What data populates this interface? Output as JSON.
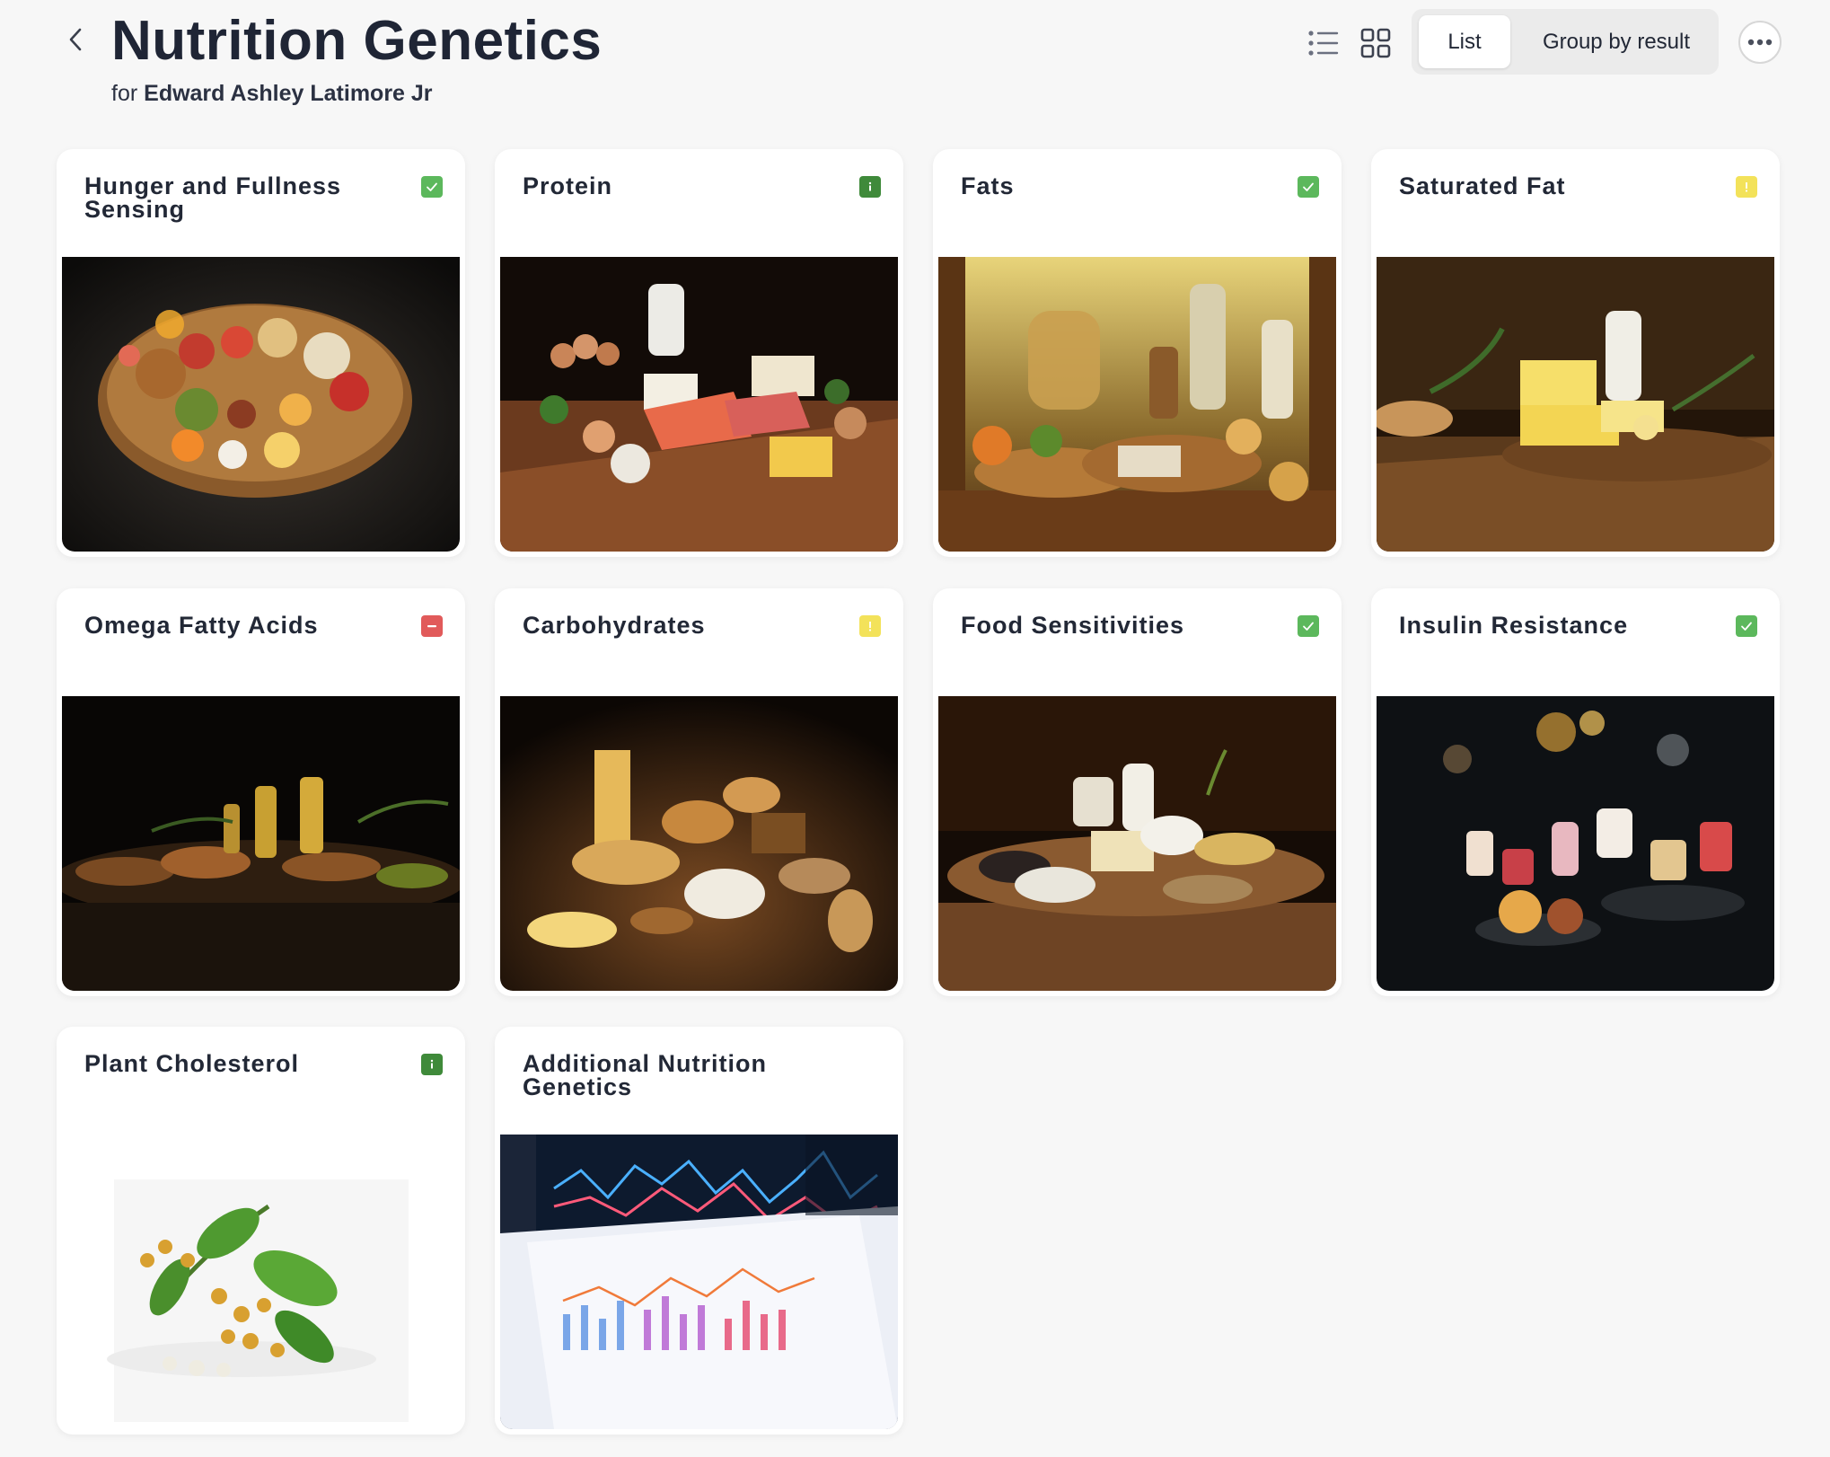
{
  "header": {
    "title": "Nutrition Genetics",
    "subtitle_prefix": "for",
    "person_name": "Edward Ashley Latimore Jr"
  },
  "toolbar": {
    "list_view_icon": "list-view-icon",
    "grid_view_icon": "grid-view-icon",
    "segments": [
      "List",
      "Group by result"
    ],
    "active_segment": "List",
    "more_icon": "more-options-icon"
  },
  "status_colors": {
    "check": "#5cb85c",
    "info": "#3f8a3a",
    "warning": "#f3e25a",
    "minus": "#e15a5a"
  },
  "cards": [
    {
      "title": "Hunger and Fullness Sensing",
      "status": "check",
      "image": "food-platter-image"
    },
    {
      "title": "Protein",
      "status": "info",
      "image": "protein-foods-image"
    },
    {
      "title": "Fats",
      "status": "check",
      "image": "fats-foods-image"
    },
    {
      "title": "Saturated Fat",
      "status": "warning",
      "image": "butter-image"
    },
    {
      "title": "Omega Fatty Acids",
      "status": "minus",
      "image": "nuts-oils-image"
    },
    {
      "title": "Carbohydrates",
      "status": "warning",
      "image": "breads-grains-image"
    },
    {
      "title": "Food Sensitivities",
      "status": "check",
      "image": "dairy-grains-image"
    },
    {
      "title": "Insulin Resistance",
      "status": "check",
      "image": "desserts-image"
    },
    {
      "title": "Plant Cholesterol",
      "status": "info",
      "image": "plant-berries-image"
    },
    {
      "title": "Additional Nutrition Genetics",
      "status": "none",
      "image": "data-charts-image"
    }
  ]
}
